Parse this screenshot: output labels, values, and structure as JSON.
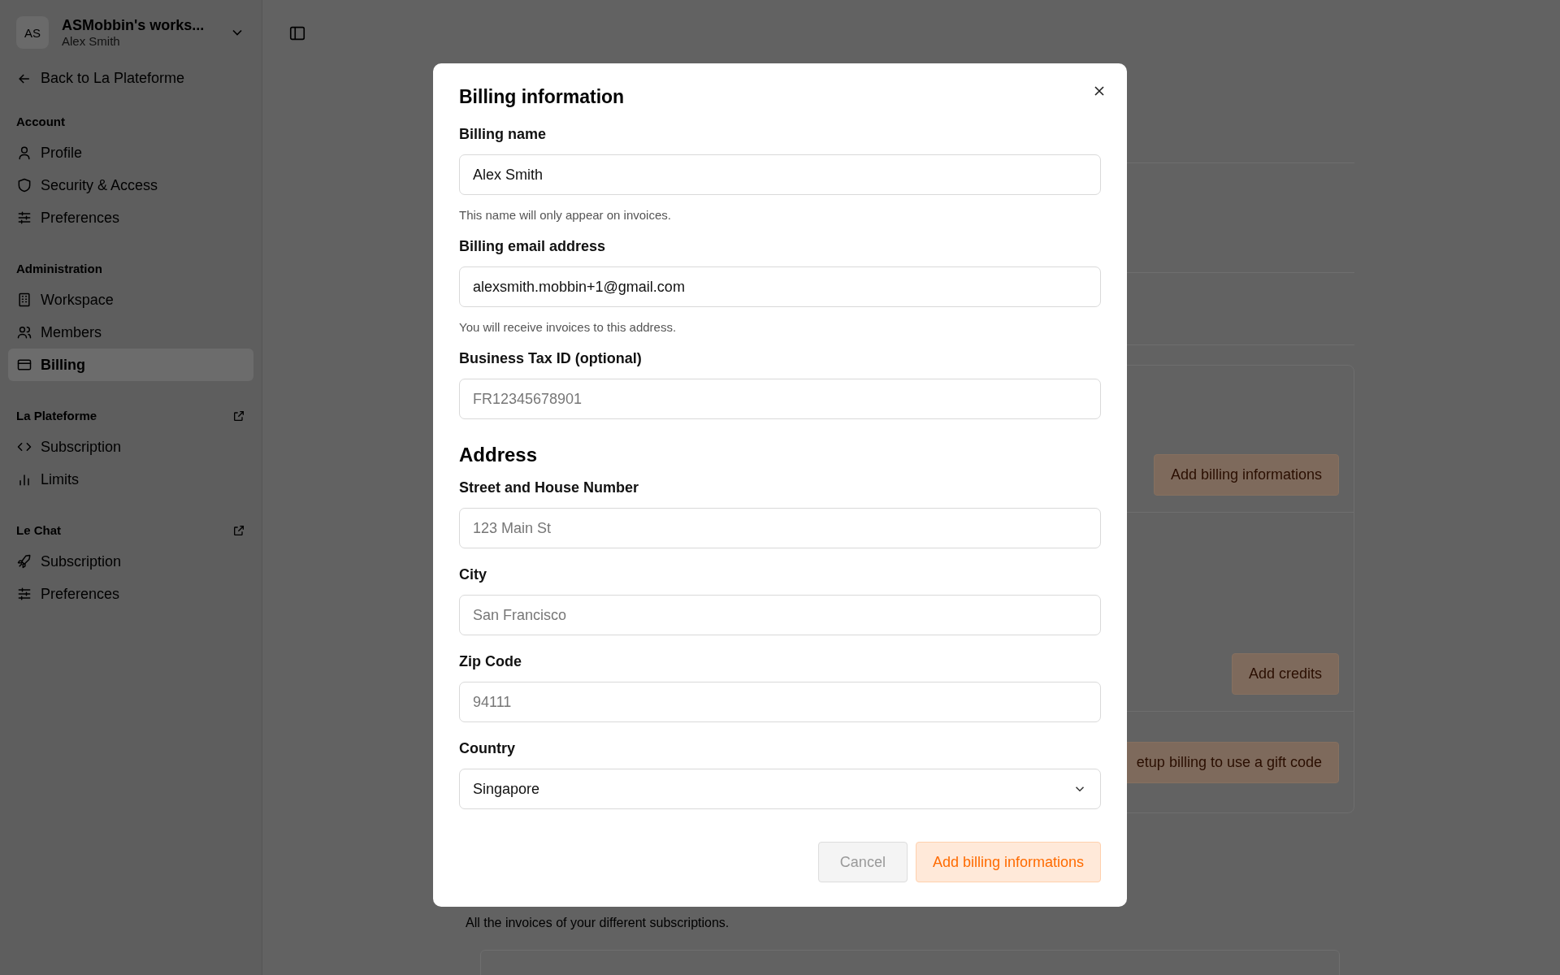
{
  "workspace": {
    "avatar": "AS",
    "name": "ASMobbin's works...",
    "user": "Alex Smith"
  },
  "back_link": "Back to La Plateforme",
  "sidebar": {
    "sections": [
      {
        "title": "Account",
        "external": false,
        "items": [
          {
            "label": "Profile",
            "selected": false
          },
          {
            "label": "Security & Access",
            "selected": false
          },
          {
            "label": "Preferences",
            "selected": false
          }
        ]
      },
      {
        "title": "Administration",
        "external": false,
        "items": [
          {
            "label": "Workspace",
            "selected": false
          },
          {
            "label": "Members",
            "selected": false
          },
          {
            "label": "Billing",
            "selected": true
          }
        ]
      },
      {
        "title": "La Plateforme",
        "external": true,
        "items": [
          {
            "label": "Subscription",
            "selected": false
          },
          {
            "label": "Limits",
            "selected": false
          }
        ]
      },
      {
        "title": "Le Chat",
        "external": true,
        "items": [
          {
            "label": "Subscription",
            "selected": false
          },
          {
            "label": "Preferences",
            "selected": false
          }
        ]
      }
    ]
  },
  "background": {
    "buttons": [
      "Add billing informations",
      "Add credits",
      "etup billing to use a gift code"
    ],
    "invoices_description": "All the invoices of your different subscriptions."
  },
  "modal": {
    "title": "Billing information",
    "sections": [
      {
        "fields": [
          {
            "kind": "input",
            "label": "Billing name",
            "value": "Alex Smith",
            "hint": "This name will only appear on invoices."
          },
          {
            "kind": "input",
            "label": "Billing email address",
            "value": "alexsmith.mobbin+1@gmail.com",
            "hint": "You will receive invoices to this address."
          },
          {
            "kind": "input",
            "label": "Business Tax ID (optional)",
            "placeholder": "FR12345678901"
          }
        ]
      },
      {
        "heading": "Address",
        "fields": [
          {
            "kind": "input",
            "label": "Street and House Number",
            "placeholder": "123 Main St"
          },
          {
            "kind": "input",
            "label": "City",
            "placeholder": "San Francisco"
          },
          {
            "kind": "input",
            "label": "Zip Code",
            "placeholder": "94111"
          },
          {
            "kind": "select",
            "label": "Country",
            "value": "Singapore"
          }
        ]
      }
    ],
    "buttons": [
      {
        "label": "Cancel",
        "kind": "secondary"
      },
      {
        "label": "Add billing informations",
        "kind": "primary"
      }
    ]
  }
}
